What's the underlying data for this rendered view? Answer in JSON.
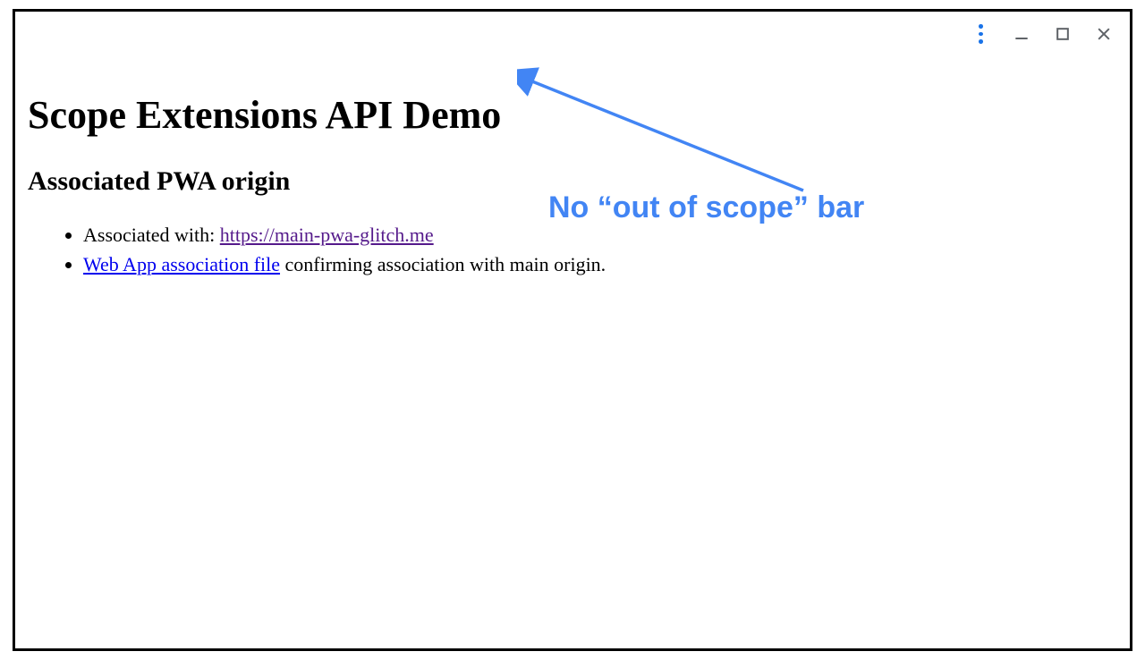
{
  "window": {
    "menu_icon": "vertical-dots",
    "minimize_icon": "minimize",
    "maximize_icon": "maximize",
    "close_icon": "close"
  },
  "page": {
    "title": "Scope Extensions API Demo",
    "subheading": "Associated PWA origin",
    "list": {
      "item1_prefix": "Associated with: ",
      "item1_link_text": "https://main-pwa-glitch.me",
      "item2_link_text": "Web App association file",
      "item2_suffix": " confirming association with main origin."
    }
  },
  "annotation": {
    "text": "No “out of scope” bar",
    "color": "#4285f4"
  }
}
